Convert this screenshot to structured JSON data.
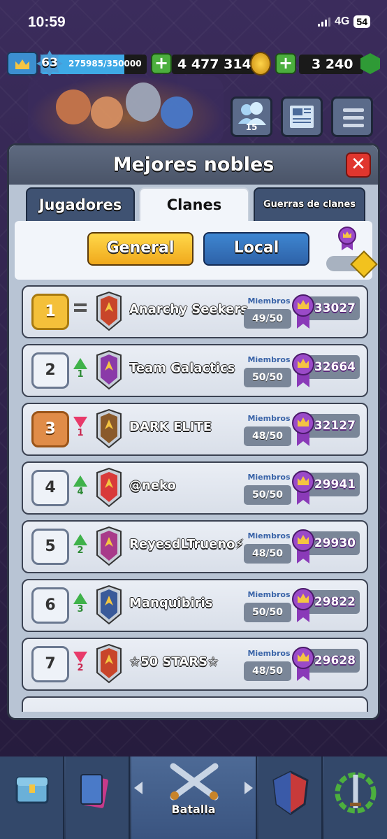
{
  "status_bar": {
    "time": "10:59",
    "network": "4G",
    "battery": "54"
  },
  "resources": {
    "level": "63",
    "xp_text": "275985/350000",
    "xp_progress": 0.7885,
    "gold": "4 477 314",
    "gems": "3 240"
  },
  "friends": {
    "online_count": "15"
  },
  "panel": {
    "title": "Mejores nobles",
    "tabs": [
      {
        "label": "Jugadores",
        "active": false
      },
      {
        "label": "Clanes",
        "active": true
      },
      {
        "label": "Guerras de clanes",
        "active": false
      }
    ],
    "scope_buttons": {
      "general": "General",
      "local": "Local"
    },
    "members_label": "Miembros"
  },
  "clans": [
    {
      "rank": "1",
      "trend": "same",
      "delta": "",
      "name": "Anarchy Seekers",
      "members": "49/50",
      "trophies": "33027",
      "badge_color": "#c8452a"
    },
    {
      "rank": "2",
      "trend": "up",
      "delta": "1",
      "name": "Team Galactics",
      "members": "50/50",
      "trophies": "32664",
      "badge_color": "#8a3aa8"
    },
    {
      "rank": "3",
      "trend": "down",
      "delta": "1",
      "name": "DARK ELITE",
      "members": "48/50",
      "trophies": "32127",
      "badge_color": "#8a5a2a"
    },
    {
      "rank": "4",
      "trend": "up",
      "delta": "4",
      "name": "@neko",
      "members": "50/50",
      "trophies": "29941",
      "badge_color": "#d83a3a"
    },
    {
      "rank": "5",
      "trend": "up",
      "delta": "2",
      "name": "ReyesdLTrueno⚡",
      "members": "48/50",
      "trophies": "29930",
      "badge_color": "#a83a8a"
    },
    {
      "rank": "6",
      "trend": "up",
      "delta": "3",
      "name": "Manquibiris",
      "members": "50/50",
      "trophies": "29822",
      "badge_color": "#3a5a9a"
    },
    {
      "rank": "7",
      "trend": "down",
      "delta": "2",
      "name": "☆50 STARS☆",
      "members": "48/50",
      "trophies": "29628",
      "badge_color": "#c8452a"
    }
  ],
  "bottom_nav": {
    "active_label": "Batalla"
  },
  "colors": {
    "gold_rank": "#f4c03a",
    "bronze_rank": "#e08c48",
    "trend_up": "#3fb24a",
    "trend_down": "#e83a6a",
    "trophy_purple": "#8a3ab8"
  }
}
